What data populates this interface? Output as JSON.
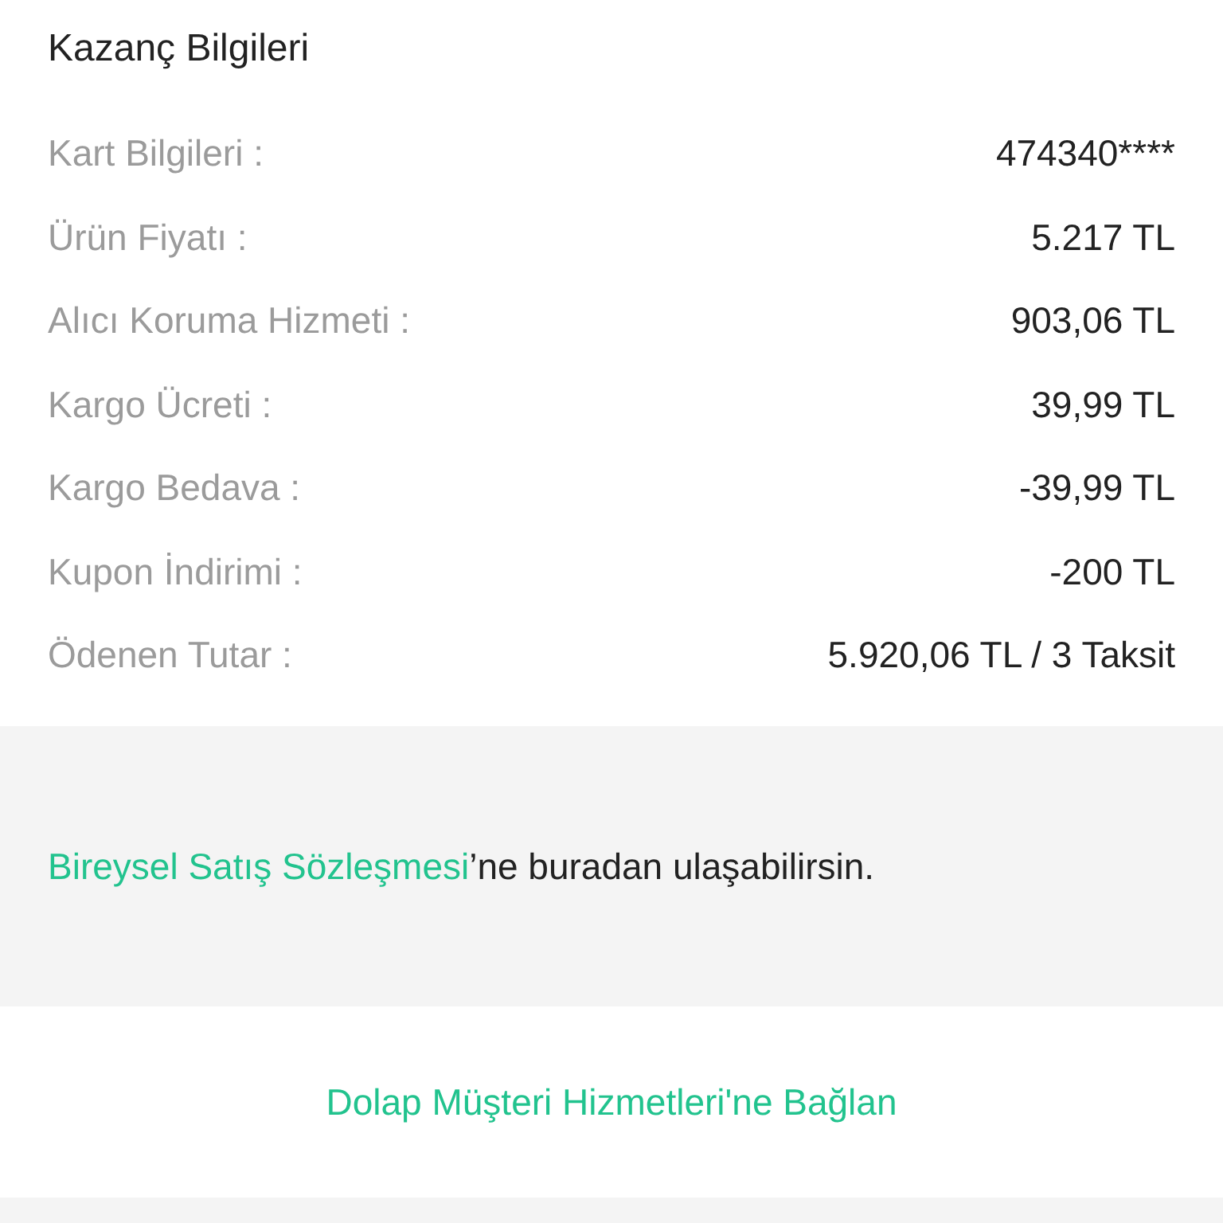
{
  "title": "Kazanç Bilgileri",
  "rows": [
    {
      "label": "Kart Bilgileri :",
      "value": "474340****"
    },
    {
      "label": "Ürün Fiyatı :",
      "value": "5.217 TL"
    },
    {
      "label": "Alıcı Koruma Hizmeti :",
      "value": "903,06 TL"
    },
    {
      "label": "Kargo Ücreti :",
      "value": "39,99 TL"
    },
    {
      "label": "Kargo Bedava :",
      "value": "-39,99 TL"
    },
    {
      "label": "Kupon İndirimi :",
      "value": "-200 TL"
    },
    {
      "label": "Ödenen Tutar :",
      "value": "5.920,06 TL / 3 Taksit"
    }
  ],
  "contract_note": {
    "link": "Bireysel Satış Sözleşmesi",
    "text": "’ne buradan ulaşabilirsin."
  },
  "support_link": "Dolap Müşteri Hizmetleri'ne Bağlan"
}
